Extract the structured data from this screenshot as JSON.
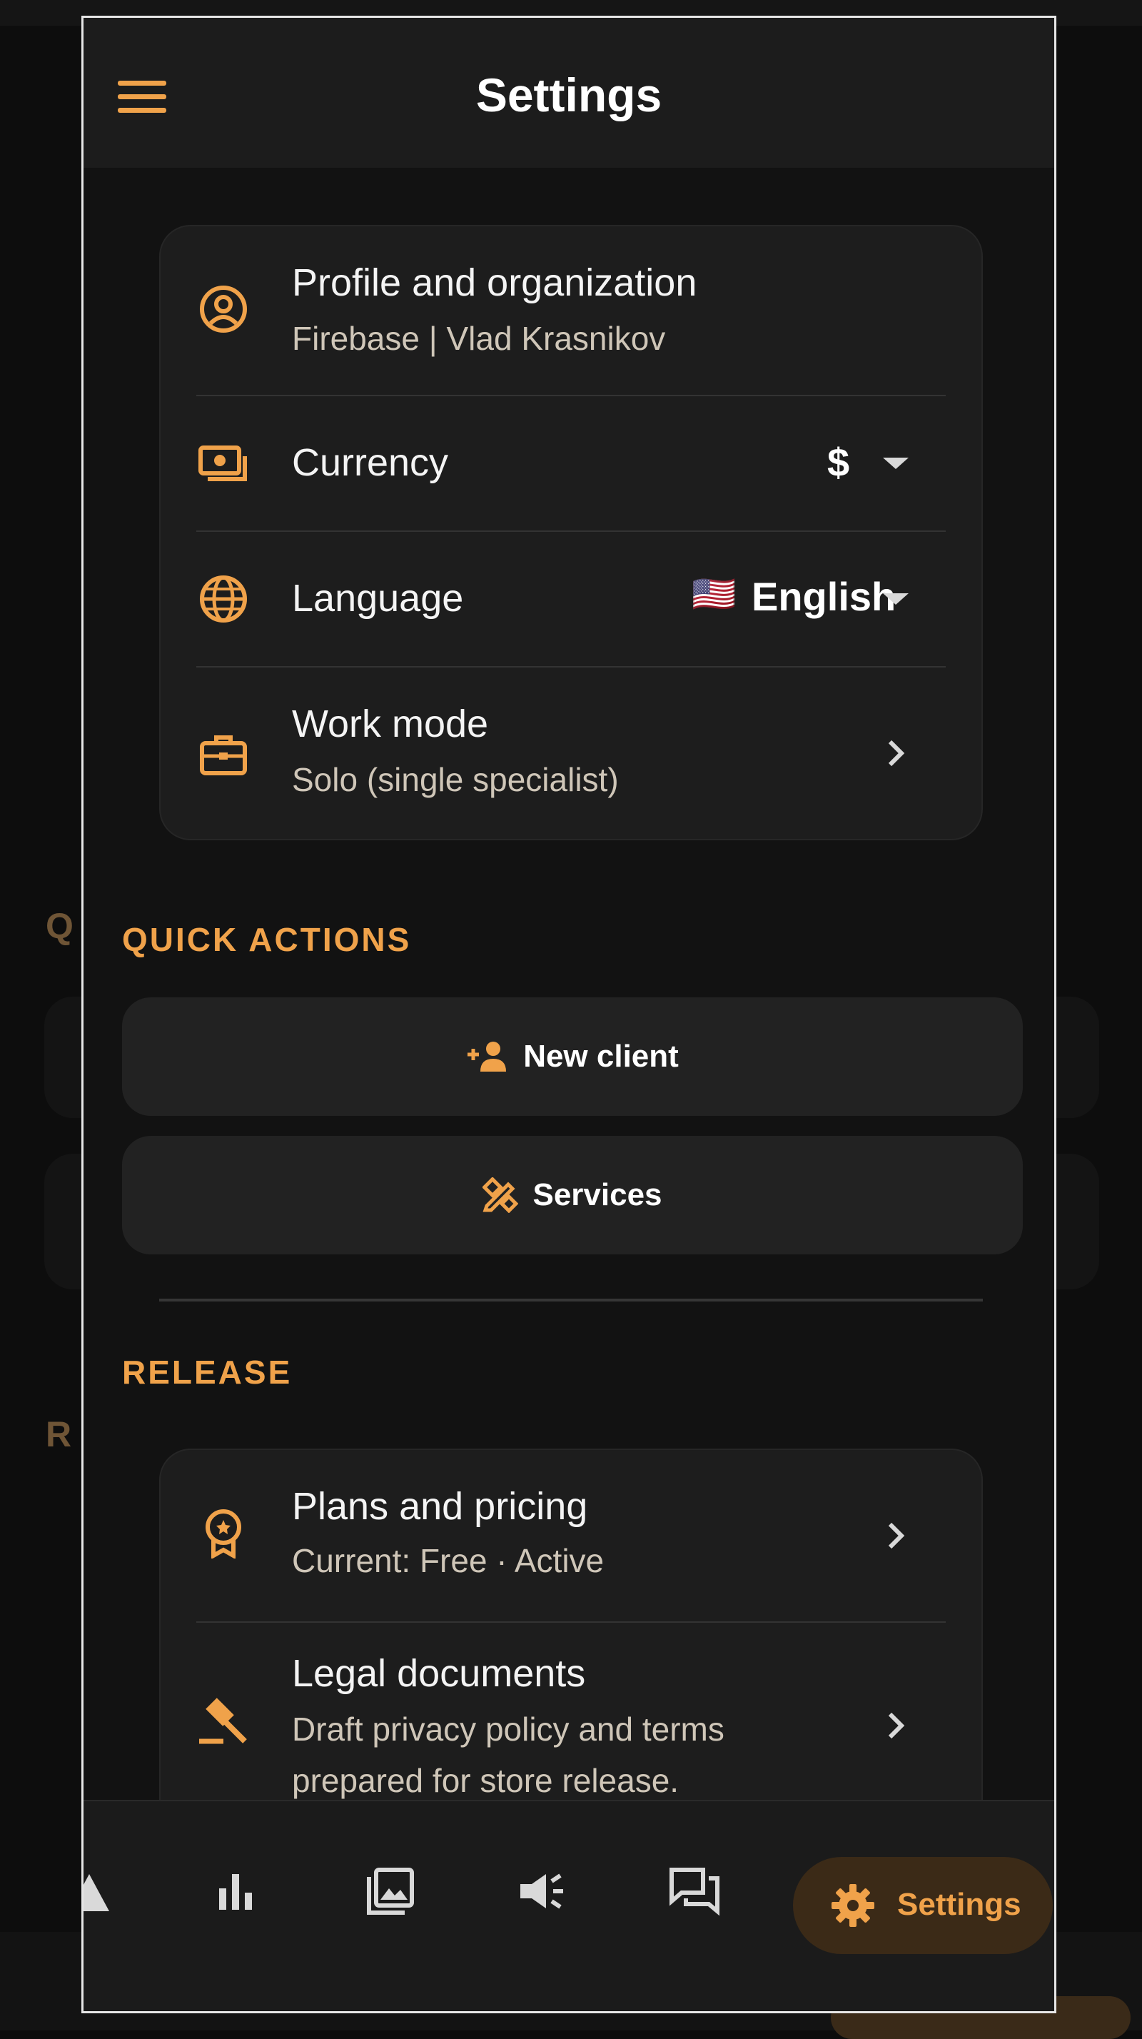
{
  "app": {
    "title": "Settings"
  },
  "background": {
    "heading_q": "Q",
    "heading_r": "R"
  },
  "profile_card": {
    "profile": {
      "title": "Profile and organization",
      "subtitle": "Firebase | Vlad Krasnikov",
      "icon": "account-circle-icon"
    },
    "currency": {
      "title": "Currency",
      "value": "$",
      "icon": "money-icon"
    },
    "language": {
      "title": "Language",
      "flag": "🇺🇸",
      "value": "English",
      "icon": "globe-icon"
    },
    "work_mode": {
      "title": "Work mode",
      "subtitle": "Solo (single specialist)",
      "icon": "briefcase-icon"
    }
  },
  "quick_actions": {
    "heading": "QUICK ACTIONS",
    "new_client": {
      "label": "New client",
      "icon": "person-add-icon"
    },
    "services": {
      "label": "Services",
      "icon": "design-services-icon"
    }
  },
  "release": {
    "heading": "RELEASE",
    "plans": {
      "title": "Plans and pricing",
      "subtitle": "Current: Free · Active",
      "icon": "premium-badge-icon"
    },
    "legal": {
      "title": "Legal documents",
      "subtitle_line1": "Draft privacy policy and terms",
      "subtitle_line2": "prepared for store release.",
      "icon": "gavel-icon"
    }
  },
  "navbar": {
    "items": [
      "dashboard-icon",
      "bar-chart-icon",
      "gallery-icon",
      "campaign-icon",
      "chat-icon"
    ],
    "active": {
      "label": "Settings",
      "icon": "gear-icon"
    }
  },
  "colors": {
    "accent": "#f0a24a",
    "background": "#121212",
    "card": "#1d1d1d",
    "active_pill": "#3b2a17"
  }
}
